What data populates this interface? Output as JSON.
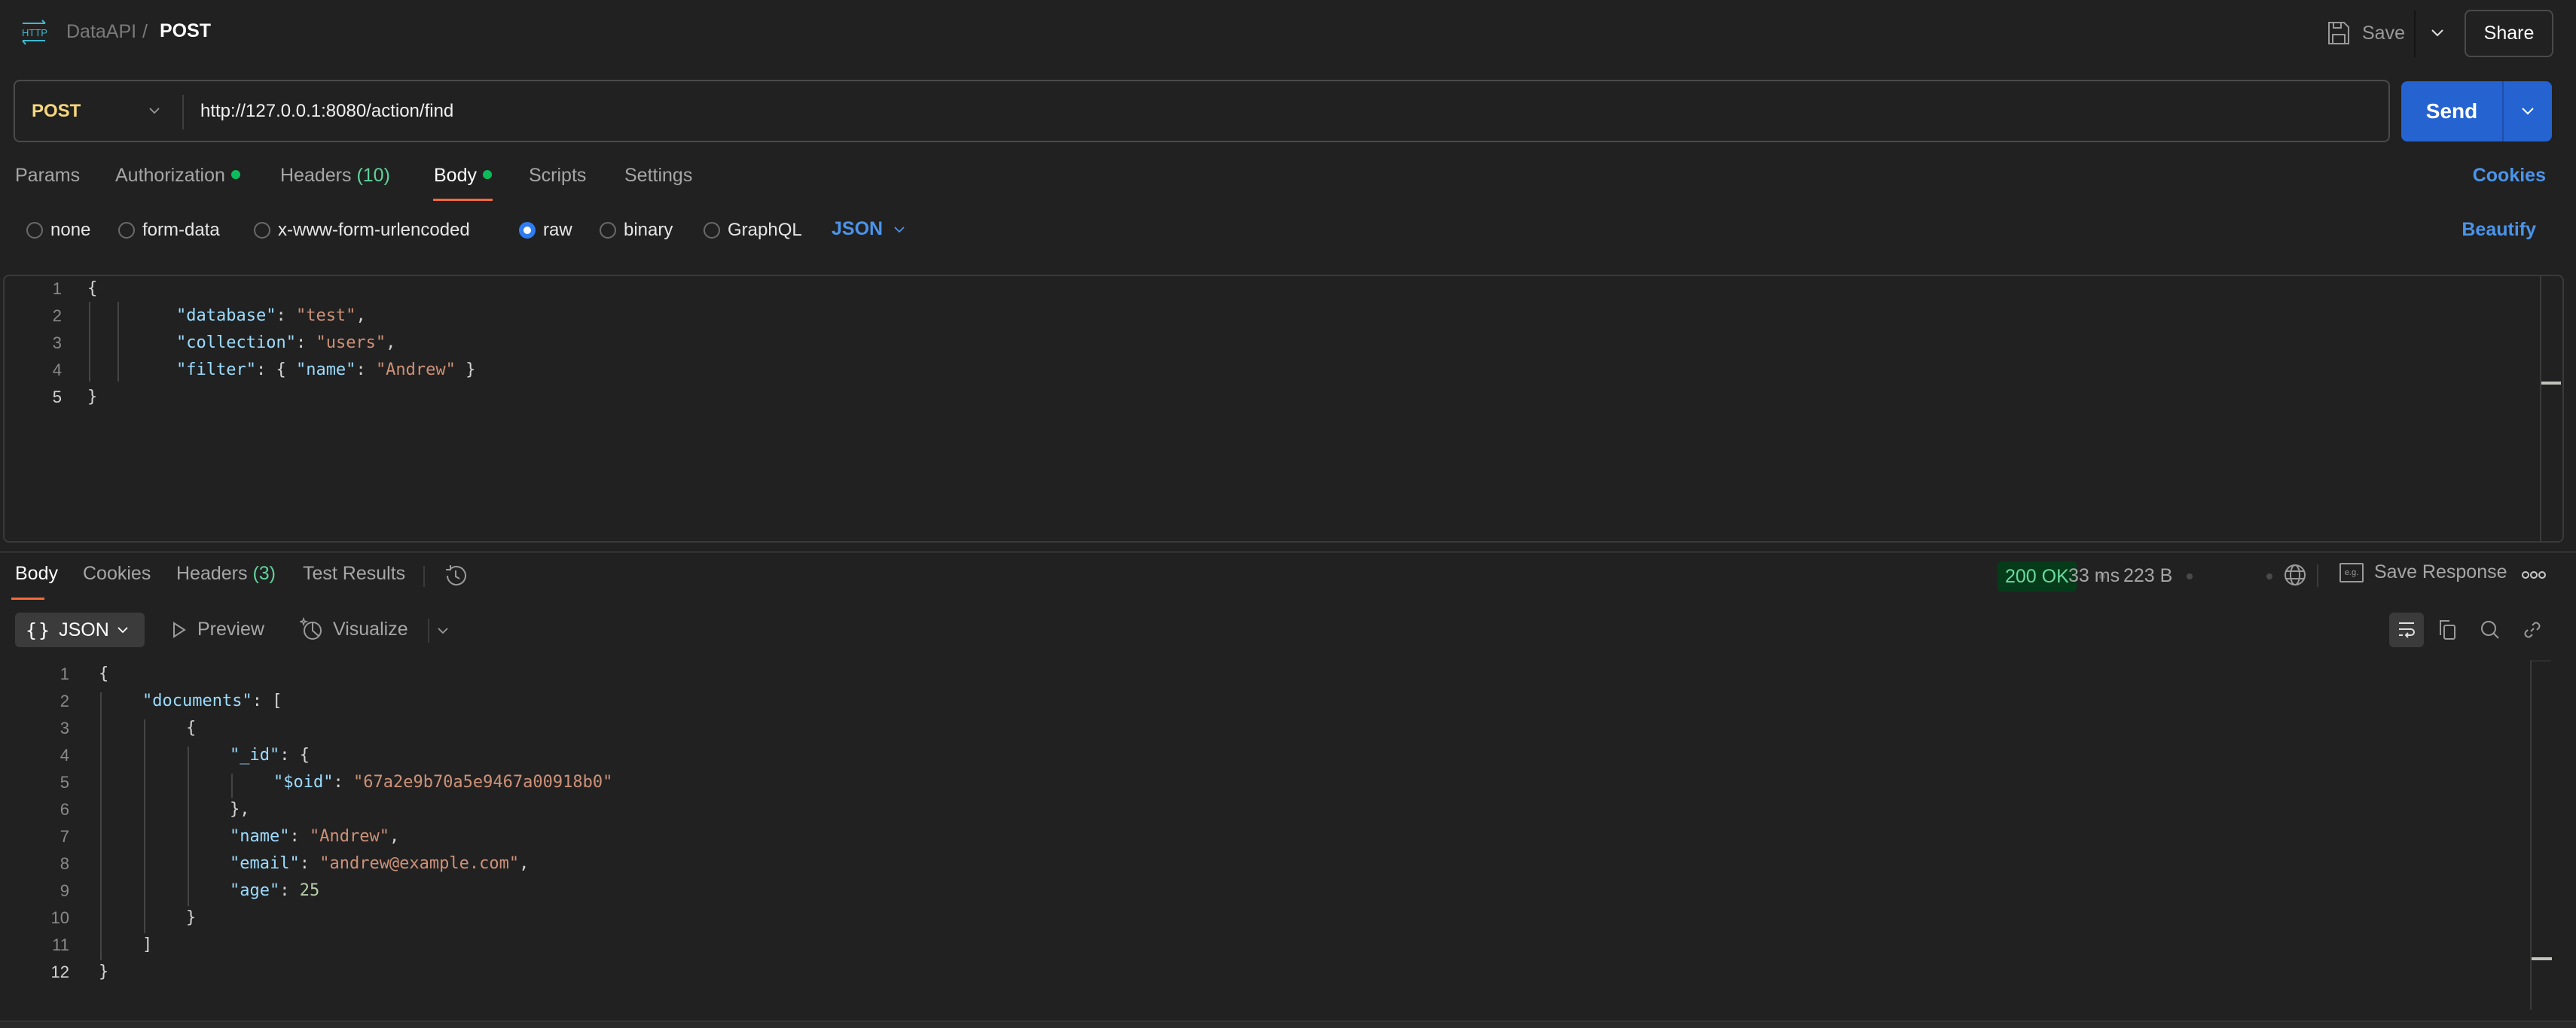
{
  "header": {
    "breadcrumb_parent": "DataAPI",
    "breadcrumb_separator": "/",
    "breadcrumb_current": "POST",
    "save_label": "Save",
    "share_label": "Share",
    "icon": "http-icon"
  },
  "request": {
    "method": "POST",
    "url": "http://127.0.0.1:8080/action/find",
    "send_label": "Send",
    "tabs": [
      {
        "label": "Params"
      },
      {
        "label": "Authorization",
        "dot": true
      },
      {
        "label": "Headers",
        "count": "(10)"
      },
      {
        "label": "Body",
        "dot": true,
        "active": true
      },
      {
        "label": "Scripts"
      },
      {
        "label": "Settings"
      }
    ],
    "cookies_label": "Cookies",
    "body_types": [
      {
        "label": "none",
        "checked": false
      },
      {
        "label": "form-data",
        "checked": false
      },
      {
        "label": "x-www-form-urlencoded",
        "checked": false
      },
      {
        "label": "raw",
        "checked": true
      },
      {
        "label": "binary",
        "checked": false
      },
      {
        "label": "GraphQL",
        "checked": false
      }
    ],
    "language": "JSON",
    "beautify_label": "Beautify",
    "body_lines": [
      {
        "n": "1",
        "text": "{"
      },
      {
        "n": "2",
        "key": "\"database\"",
        "value": "\"test\"",
        "suffix": ","
      },
      {
        "n": "3",
        "key": "\"collection\"",
        "value": "\"users\"",
        "suffix": ","
      },
      {
        "n": "4",
        "key": "\"filter\"",
        "inner_key": "\"name\"",
        "inner_value": "\"Andrew\""
      },
      {
        "n": "5",
        "text": "}"
      }
    ]
  },
  "response": {
    "tabs": [
      {
        "label": "Body",
        "active": true
      },
      {
        "label": "Cookies"
      },
      {
        "label": "Headers",
        "count": "(3)"
      },
      {
        "label": "Test Results"
      }
    ],
    "status": "200 OK",
    "time": "33 ms",
    "size": "223 B",
    "save_response_label": "Save Response",
    "save_response_icon_text": "e.g.",
    "mode": "JSON",
    "mode_icon": "{}",
    "preview_label": "Preview",
    "visualize_label": "Visualize",
    "colors": {
      "status_bg": "#063b19",
      "status_fg": "#69dba0",
      "accent": "#f26b3a",
      "link": "#4b94ea",
      "send": "#2563d0"
    },
    "body_lines": [
      {
        "n": "1",
        "indent": 0,
        "parts": [
          [
            "p",
            "{"
          ]
        ]
      },
      {
        "n": "2",
        "indent": 1,
        "parts": [
          [
            "k",
            "\"documents\""
          ],
          [
            "p",
            ": ["
          ]
        ]
      },
      {
        "n": "3",
        "indent": 2,
        "parts": [
          [
            "p",
            "{"
          ]
        ]
      },
      {
        "n": "4",
        "indent": 3,
        "parts": [
          [
            "k",
            "\"_id\""
          ],
          [
            "p",
            ": {"
          ]
        ]
      },
      {
        "n": "5",
        "indent": 4,
        "parts": [
          [
            "k",
            "\"$oid\""
          ],
          [
            "p",
            ": "
          ],
          [
            "s",
            "\"67a2e9b70a5e9467a00918b0\""
          ]
        ]
      },
      {
        "n": "6",
        "indent": 3,
        "parts": [
          [
            "p",
            "},"
          ]
        ]
      },
      {
        "n": "7",
        "indent": 3,
        "parts": [
          [
            "k",
            "\"name\""
          ],
          [
            "p",
            ": "
          ],
          [
            "s",
            "\"Andrew\""
          ],
          [
            "p",
            ","
          ]
        ]
      },
      {
        "n": "8",
        "indent": 3,
        "parts": [
          [
            "k",
            "\"email\""
          ],
          [
            "p",
            ": "
          ],
          [
            "s",
            "\"andrew@example.com\""
          ],
          [
            "p",
            ","
          ]
        ]
      },
      {
        "n": "9",
        "indent": 3,
        "parts": [
          [
            "k",
            "\"age\""
          ],
          [
            "p",
            ": "
          ],
          [
            "n",
            "25"
          ]
        ]
      },
      {
        "n": "10",
        "indent": 2,
        "parts": [
          [
            "p",
            "}"
          ]
        ]
      },
      {
        "n": "11",
        "indent": 1,
        "parts": [
          [
            "p",
            "]"
          ]
        ]
      },
      {
        "n": "12",
        "indent": 0,
        "parts": [
          [
            "p",
            "}"
          ]
        ]
      }
    ]
  }
}
